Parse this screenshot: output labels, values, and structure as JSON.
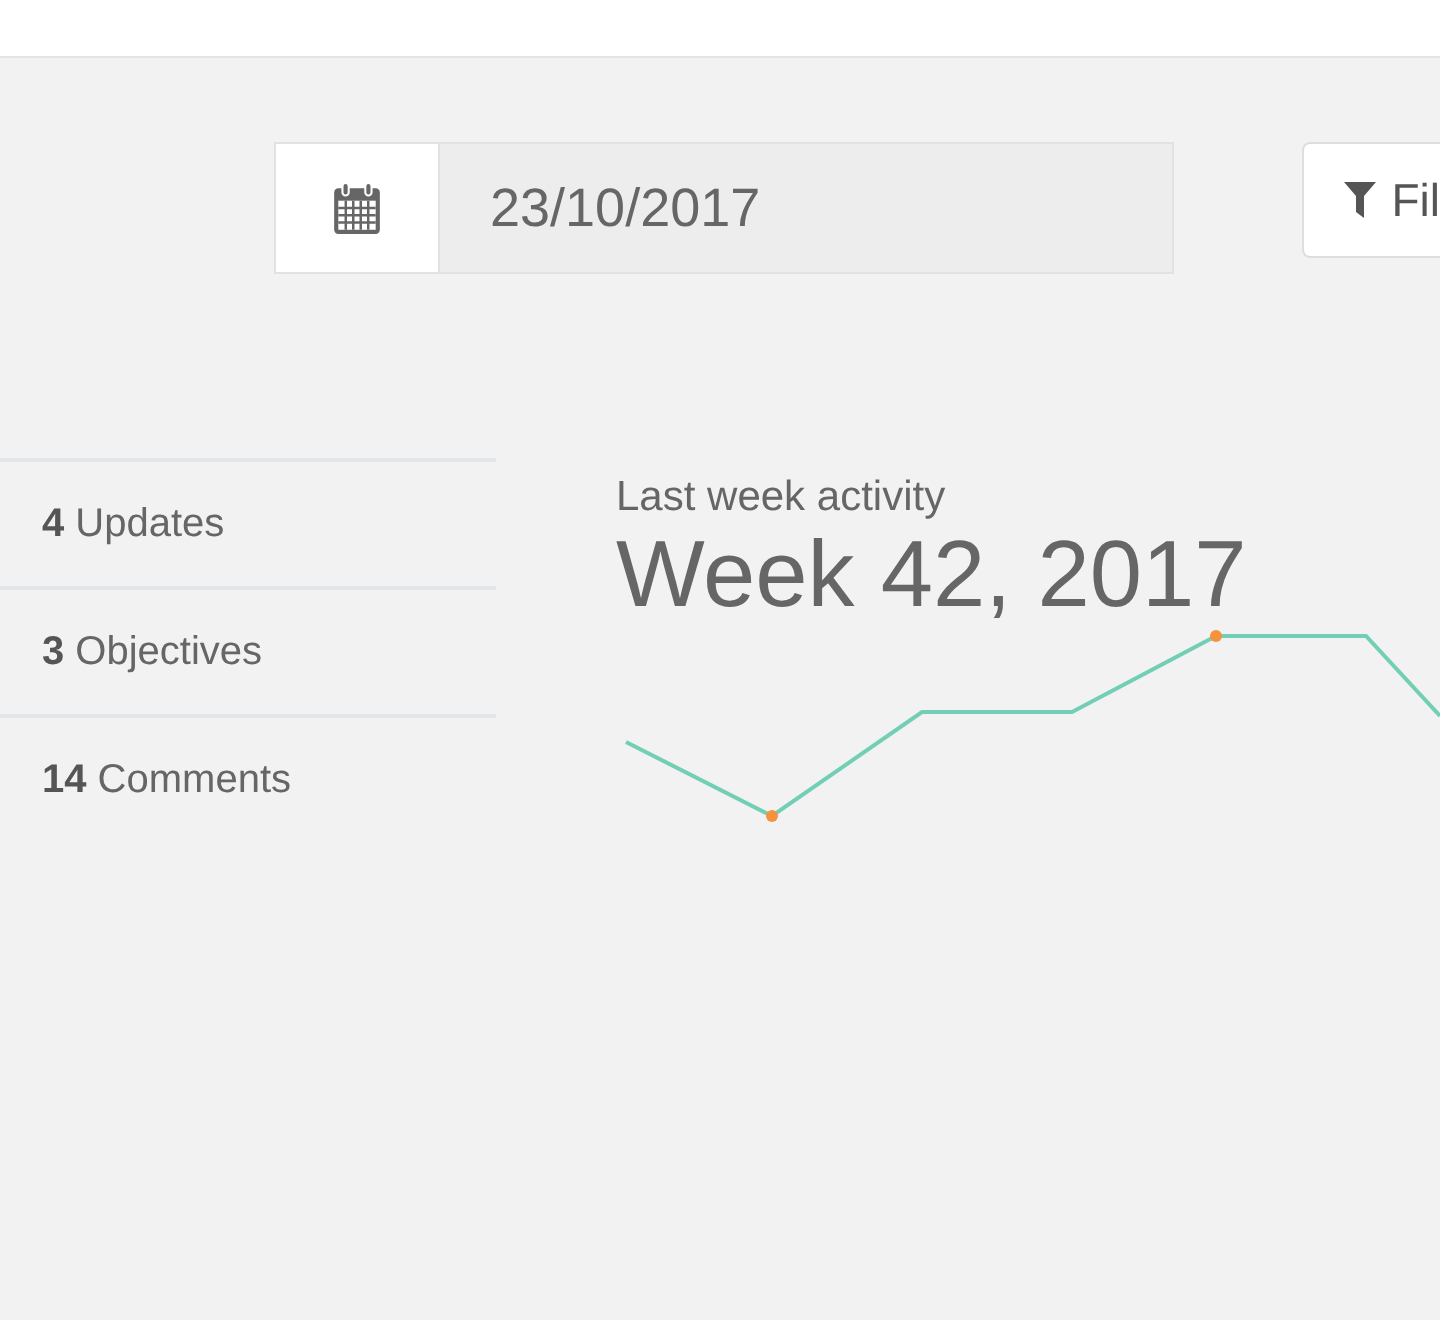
{
  "date_picker": {
    "value": "23/10/2017"
  },
  "filter_button": {
    "label": "Fil"
  },
  "stats": [
    {
      "text": "**4** Updates"
    },
    {
      "text": "**3** Objectives"
    },
    {
      "text": "**14** Comments"
    }
  ],
  "activity": {
    "title": "Last week activity",
    "heading": "Week 42, 2017"
  }
}
